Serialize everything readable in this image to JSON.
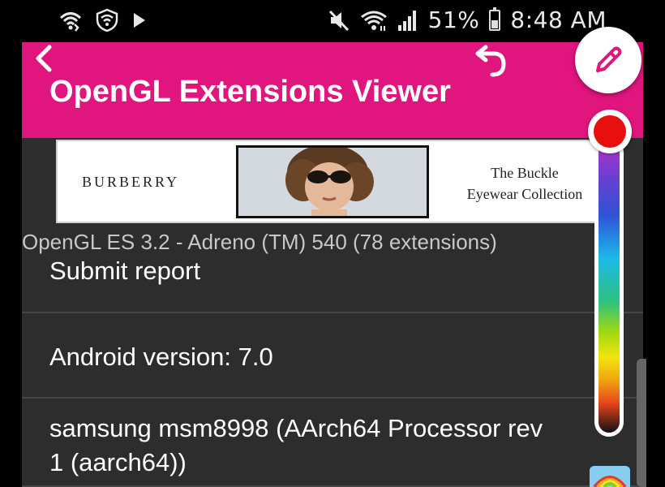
{
  "status_bar": {
    "battery_percent": "51%",
    "time": "8:48 AM",
    "icons_left": [
      "wifi-call-icon",
      "shield-vpn-icon",
      "play-store-icon"
    ],
    "icons_right": [
      "mute-icon",
      "wifi-icon",
      "signal-icon",
      "battery-icon"
    ]
  },
  "app_bar": {
    "title": "OpenGL Extensions Viewer",
    "back_icon": "back-chevron-icon",
    "undo_icon": "undo-icon",
    "color": "#e0157e"
  },
  "ad": {
    "brand": "BURBERRY",
    "tagline_line1": "The Buckle",
    "tagline_line2": "Eyewear Collection"
  },
  "gl_summary": "OpenGL ES 3.2 - Adreno (TM) 540 (78 extensions)",
  "rows": {
    "submit": "Submit report",
    "android": "Android version: 7.0",
    "device_line1": "samsung  msm8998 (AArch64 Processor rev",
    "device_line2": "1 (aarch64))"
  },
  "drawing_tools": {
    "pen_icon": "pencil-icon",
    "selected_color": "#e80f0f",
    "rainbow_icon": "rainbow-icon"
  },
  "colors": {
    "background": "#000000",
    "list_background": "#2d2d2d",
    "divider": "#454545"
  }
}
